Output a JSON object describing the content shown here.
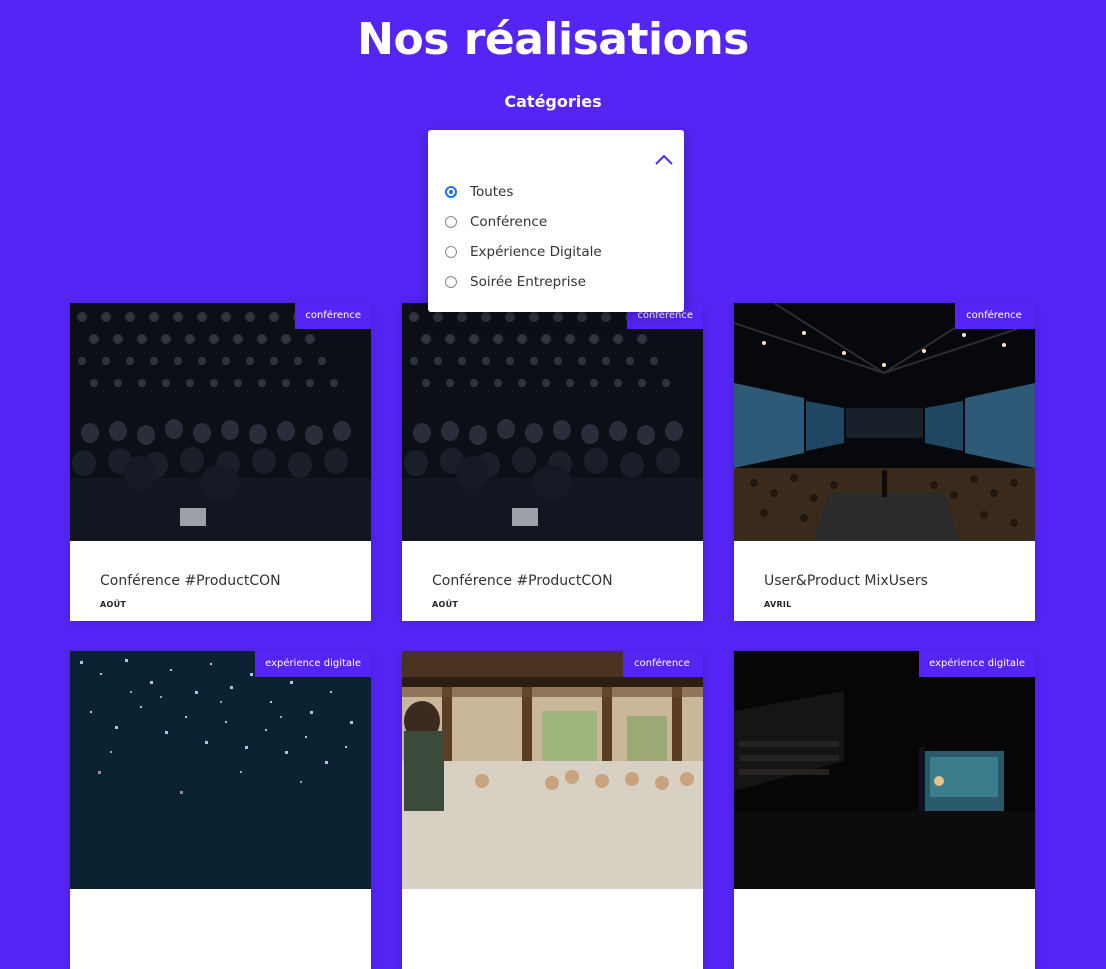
{
  "page": {
    "title": "Nos réalisations",
    "categories_label": "Catégories"
  },
  "filter": {
    "options": [
      "Toutes",
      "Conférence",
      "Expérience Digitale",
      "Soirée Entreprise"
    ],
    "selected": "Toutes"
  },
  "cards": [
    {
      "tag": "conférence",
      "title": "Conférence #ProductCON",
      "date": "AOÛT",
      "image": "audience-dark-ceiling"
    },
    {
      "tag": "conférence",
      "title": "Conférence #ProductCON",
      "date": "AOÛT",
      "image": "audience-dark-ceiling"
    },
    {
      "tag": "conférence",
      "title": "User&Product MixUsers",
      "date": "AVRIL",
      "image": "conference-hall-stage"
    },
    {
      "tag": "expérience digitale",
      "title": "",
      "date": "",
      "image": "confetti"
    },
    {
      "tag": "conférence",
      "title": "",
      "date": "",
      "image": "outdoor-speaker"
    },
    {
      "tag": "expérience digitale",
      "title": "",
      "date": "",
      "image": "dark-auditorium"
    }
  ],
  "colors": {
    "accent": "#5425f5",
    "radio": "#1a73e8"
  },
  "icons": {
    "dropdown_toggle": "chevron-up-icon"
  }
}
